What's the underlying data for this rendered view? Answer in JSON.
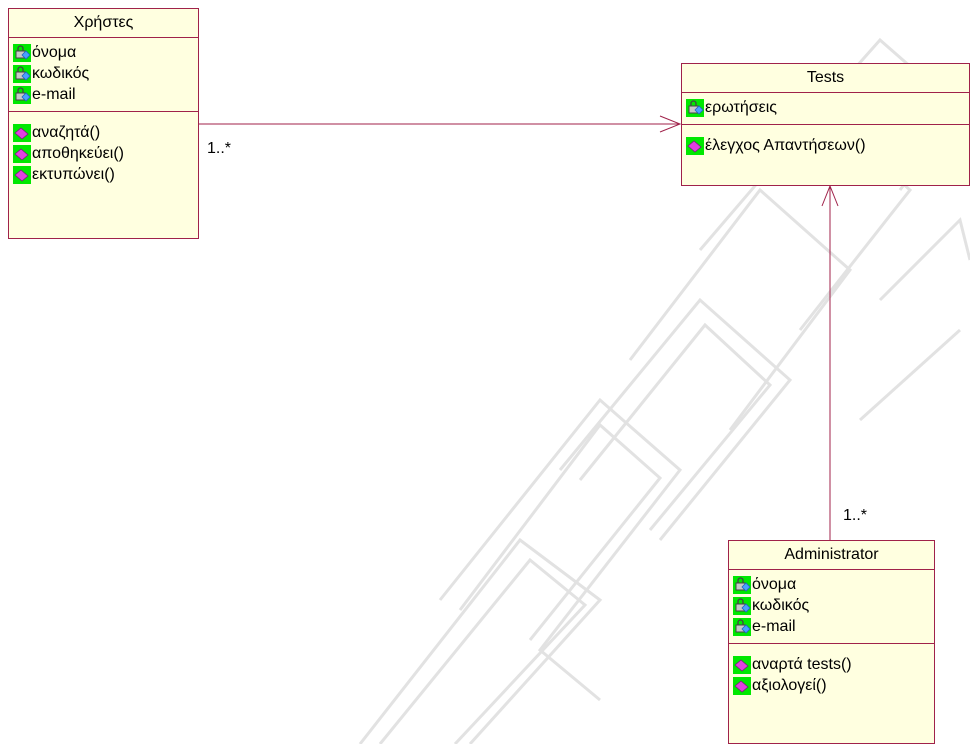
{
  "classes": {
    "users": {
      "name": "Χρήστες",
      "attributes": [
        "όνομα",
        "κωδικός",
        "e-mail"
      ],
      "operations": [
        "αναζητά()",
        "αποθηκεύει()",
        "εκτυπώνει()"
      ]
    },
    "tests": {
      "name": "Tests",
      "attributes": [
        "ερωτήσεις"
      ],
      "operations": [
        "έλεγχος Απαντήσεων()"
      ]
    },
    "administrator": {
      "name": "Administrator",
      "attributes": [
        "όνομα",
        "κωδικός",
        "e-mail"
      ],
      "operations": [
        "αναρτά tests()",
        "αξιολογεί()"
      ]
    }
  },
  "associations": {
    "users_tests": {
      "multiplicity": "1..*"
    },
    "admin_tests": {
      "multiplicity": "1..*"
    }
  },
  "colors": {
    "border": "#a0224a",
    "class_fill": "#ffffe0",
    "icon_background": "#00e800",
    "operation_icon": "#e040e0"
  },
  "icons": {
    "attribute": "private-attribute-lock-icon",
    "operation": "public-operation-diamond-icon"
  }
}
